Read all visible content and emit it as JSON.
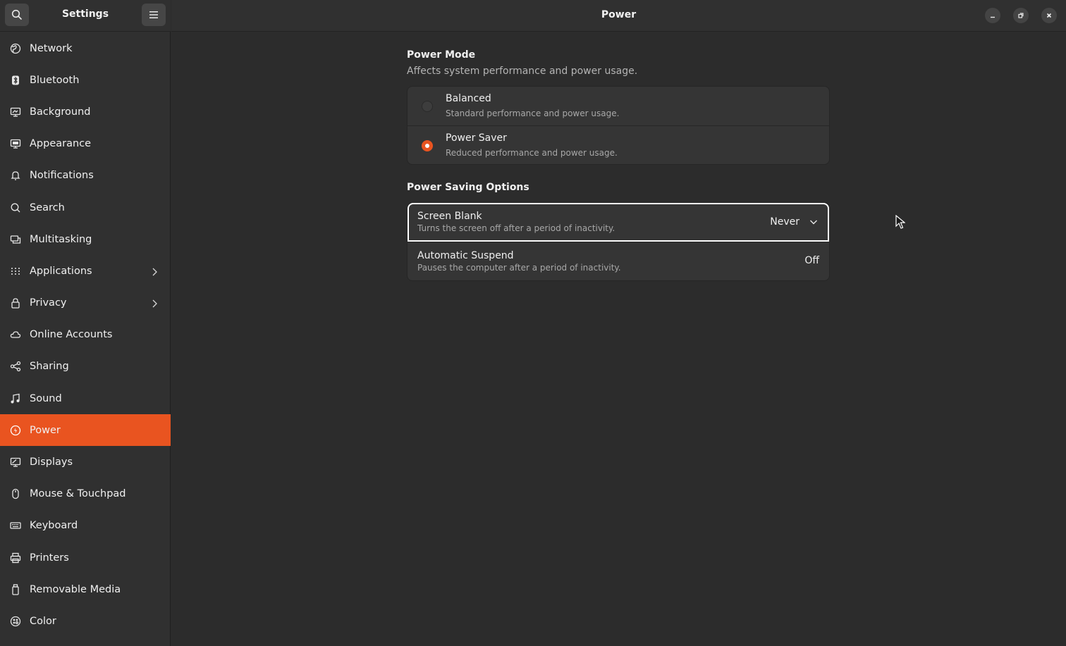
{
  "sidebar": {
    "title": "Settings",
    "search_icon": "search-icon",
    "menu_icon": "hamburger-menu-icon",
    "items": [
      {
        "label": "Network",
        "icon": "globe-icon",
        "name": "network"
      },
      {
        "label": "Bluetooth",
        "icon": "bluetooth-icon",
        "name": "bluetooth"
      },
      {
        "label": "Background",
        "icon": "background-icon",
        "name": "background"
      },
      {
        "label": "Appearance",
        "icon": "appearance-icon",
        "name": "appearance"
      },
      {
        "label": "Notifications",
        "icon": "bell-icon",
        "name": "notifications"
      },
      {
        "label": "Search",
        "icon": "search-icon",
        "name": "search"
      },
      {
        "label": "Multitasking",
        "icon": "multitasking-icon",
        "name": "multitasking"
      },
      {
        "label": "Applications",
        "icon": "grid-icon",
        "name": "applications",
        "chevron": true
      },
      {
        "label": "Privacy",
        "icon": "lock-icon",
        "name": "privacy",
        "chevron": true
      },
      {
        "label": "Online Accounts",
        "icon": "cloud-icon",
        "name": "online-accounts"
      },
      {
        "label": "Sharing",
        "icon": "share-icon",
        "name": "sharing"
      },
      {
        "label": "Sound",
        "icon": "music-note-icon",
        "name": "sound"
      },
      {
        "label": "Power",
        "icon": "power-icon",
        "name": "power",
        "active": true
      },
      {
        "label": "Displays",
        "icon": "display-icon",
        "name": "displays"
      },
      {
        "label": "Mouse & Touchpad",
        "icon": "mouse-icon",
        "name": "mouse-touchpad"
      },
      {
        "label": "Keyboard",
        "icon": "keyboard-icon",
        "name": "keyboard"
      },
      {
        "label": "Printers",
        "icon": "printer-icon",
        "name": "printers"
      },
      {
        "label": "Removable Media",
        "icon": "removable-media-icon",
        "name": "removable-media"
      },
      {
        "label": "Color",
        "icon": "color-icon",
        "name": "color"
      }
    ]
  },
  "header": {
    "title": "Power"
  },
  "power_mode": {
    "title": "Power Mode",
    "subtitle": "Affects system performance and power usage.",
    "options": [
      {
        "title": "Balanced",
        "subtitle": "Standard performance and power usage.",
        "selected": false
      },
      {
        "title": "Power Saver",
        "subtitle": "Reduced performance and power usage.",
        "selected": true
      }
    ]
  },
  "power_saving": {
    "title": "Power Saving Options",
    "screen_blank": {
      "title": "Screen Blank",
      "subtitle": "Turns the screen off after a period of inactivity.",
      "value": "Never"
    },
    "auto_suspend": {
      "title": "Automatic Suspend",
      "subtitle": "Pauses the computer after a period of inactivity.",
      "value": "Off"
    }
  },
  "colors": {
    "accent": "#e95420",
    "background": "#2c2c2c",
    "sidebar": "#303030"
  }
}
